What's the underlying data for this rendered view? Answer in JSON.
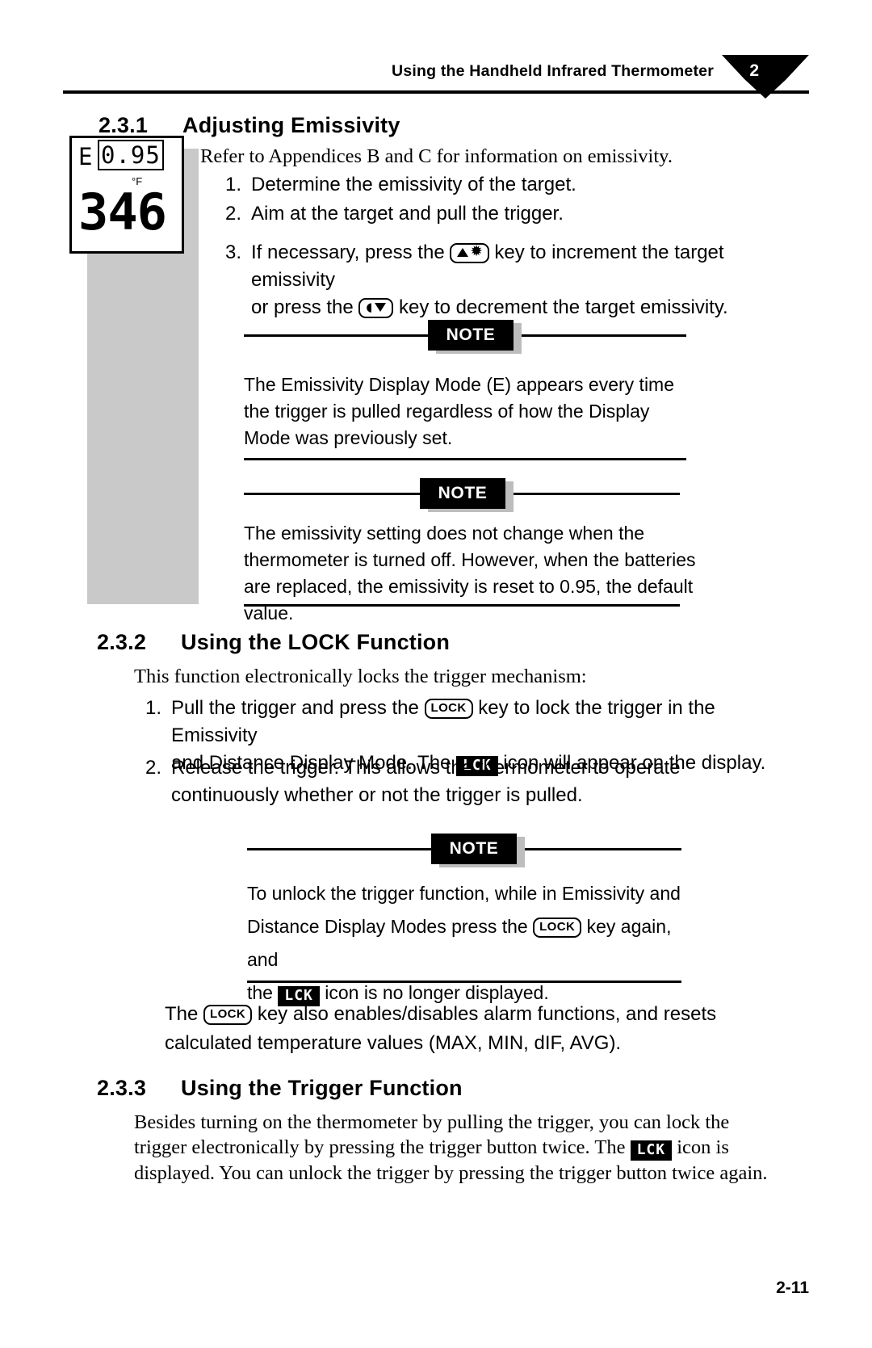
{
  "header": {
    "title": "Using the Handheld Infrared Thermometer",
    "chapter_number": "2"
  },
  "lcd": {
    "mode_letter": "E",
    "emissivity_value": "0.95",
    "unit": "°F",
    "temperature": "346"
  },
  "sections": [
    {
      "number": "2.3.1",
      "title": "Adjusting Emissivity",
      "intro": "Refer to Appendices B and C for information on emissivity.",
      "steps": [
        {
          "marker": "1.",
          "text": "Determine the emissivity of the target."
        },
        {
          "marker": "2.",
          "text": "Aim at the target and pull the trigger."
        },
        {
          "marker": "3.",
          "line1_a": "If necessary, press the",
          "line1_b": "key to increment the target emissivity",
          "line2_a": "or press the",
          "line2_b": "key to decrement the target emissivity."
        }
      ],
      "notes": [
        {
          "tag": "NOTE",
          "text": "The Emissivity Display Mode (E) appears every time the trigger is pulled regardless of how the Display Mode was previously set."
        },
        {
          "tag": "NOTE",
          "text": "The emissivity setting does not change when the thermometer is turned off. However, when the batteries are replaced, the emissivity is reset to 0.95, the default value."
        }
      ]
    },
    {
      "number": "2.3.2",
      "title": "Using the LOCK Function",
      "intro": "This function electronically locks the trigger mechanism:",
      "steps": [
        {
          "marker": "1.",
          "line1_a": "Pull the trigger and press the",
          "line1_b": "key to lock the trigger in the Emissivity",
          "line2_a": "and Distance Display Mode. The",
          "line2_b": "icon will appear on the display."
        },
        {
          "marker": "2.",
          "text": "Release the trigger. This allows the thermometer to operate continuously whether or not the trigger is pulled."
        }
      ],
      "note": {
        "tag": "NOTE",
        "line1": "To unlock the trigger function, while in Emissivity and",
        "line2_a": "Distance Display Modes press the",
        "line2_b": "key again, and",
        "line3_a": "the",
        "line3_b": "icon is no longer displayed."
      },
      "closing": {
        "a": "The",
        "b": "key also enables/disables alarm functions, and resets calculated temperature values (MAX, MIN, dIF, AVG)."
      }
    },
    {
      "number": "2.3.3",
      "title": "Using the Trigger Function",
      "paragraph_a": "Besides turning on the thermometer by pulling the trigger, you can lock the trigger electronically by pressing the trigger button twice. The",
      "paragraph_b": "icon is displayed. You can unlock the trigger by pressing the trigger button twice again."
    }
  ],
  "keys": {
    "up_key_label": "▲☀",
    "down_key_label": "⌂▼",
    "lock_key_label": "LOCK",
    "lck_icon_label": "LCK"
  },
  "note_tag_label": "NOTE",
  "footer": {
    "page_number": "2-11"
  }
}
